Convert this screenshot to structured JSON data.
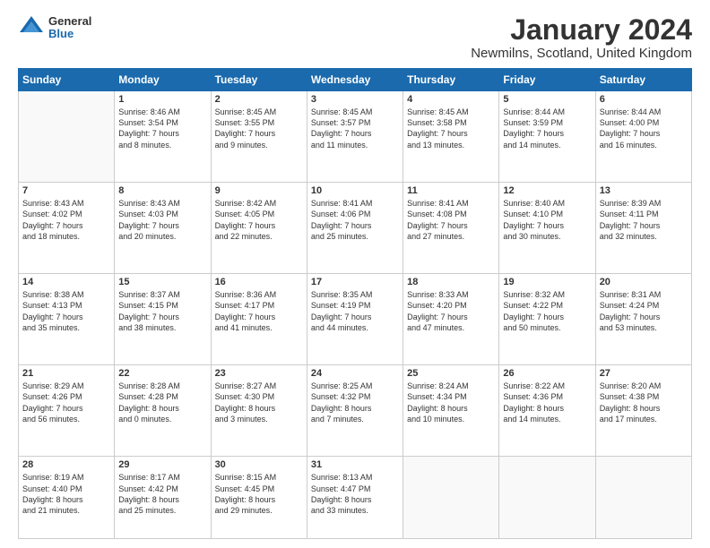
{
  "logo": {
    "general": "General",
    "blue": "Blue"
  },
  "title": "January 2024",
  "location": "Newmilns, Scotland, United Kingdom",
  "days_of_week": [
    "Sunday",
    "Monday",
    "Tuesday",
    "Wednesday",
    "Thursday",
    "Friday",
    "Saturday"
  ],
  "weeks": [
    [
      {
        "day": "",
        "info": ""
      },
      {
        "day": "1",
        "info": "Sunrise: 8:46 AM\nSunset: 3:54 PM\nDaylight: 7 hours\nand 8 minutes."
      },
      {
        "day": "2",
        "info": "Sunrise: 8:45 AM\nSunset: 3:55 PM\nDaylight: 7 hours\nand 9 minutes."
      },
      {
        "day": "3",
        "info": "Sunrise: 8:45 AM\nSunset: 3:57 PM\nDaylight: 7 hours\nand 11 minutes."
      },
      {
        "day": "4",
        "info": "Sunrise: 8:45 AM\nSunset: 3:58 PM\nDaylight: 7 hours\nand 13 minutes."
      },
      {
        "day": "5",
        "info": "Sunrise: 8:44 AM\nSunset: 3:59 PM\nDaylight: 7 hours\nand 14 minutes."
      },
      {
        "day": "6",
        "info": "Sunrise: 8:44 AM\nSunset: 4:00 PM\nDaylight: 7 hours\nand 16 minutes."
      }
    ],
    [
      {
        "day": "7",
        "info": "Sunrise: 8:43 AM\nSunset: 4:02 PM\nDaylight: 7 hours\nand 18 minutes."
      },
      {
        "day": "8",
        "info": "Sunrise: 8:43 AM\nSunset: 4:03 PM\nDaylight: 7 hours\nand 20 minutes."
      },
      {
        "day": "9",
        "info": "Sunrise: 8:42 AM\nSunset: 4:05 PM\nDaylight: 7 hours\nand 22 minutes."
      },
      {
        "day": "10",
        "info": "Sunrise: 8:41 AM\nSunset: 4:06 PM\nDaylight: 7 hours\nand 25 minutes."
      },
      {
        "day": "11",
        "info": "Sunrise: 8:41 AM\nSunset: 4:08 PM\nDaylight: 7 hours\nand 27 minutes."
      },
      {
        "day": "12",
        "info": "Sunrise: 8:40 AM\nSunset: 4:10 PM\nDaylight: 7 hours\nand 30 minutes."
      },
      {
        "day": "13",
        "info": "Sunrise: 8:39 AM\nSunset: 4:11 PM\nDaylight: 7 hours\nand 32 minutes."
      }
    ],
    [
      {
        "day": "14",
        "info": "Sunrise: 8:38 AM\nSunset: 4:13 PM\nDaylight: 7 hours\nand 35 minutes."
      },
      {
        "day": "15",
        "info": "Sunrise: 8:37 AM\nSunset: 4:15 PM\nDaylight: 7 hours\nand 38 minutes."
      },
      {
        "day": "16",
        "info": "Sunrise: 8:36 AM\nSunset: 4:17 PM\nDaylight: 7 hours\nand 41 minutes."
      },
      {
        "day": "17",
        "info": "Sunrise: 8:35 AM\nSunset: 4:19 PM\nDaylight: 7 hours\nand 44 minutes."
      },
      {
        "day": "18",
        "info": "Sunrise: 8:33 AM\nSunset: 4:20 PM\nDaylight: 7 hours\nand 47 minutes."
      },
      {
        "day": "19",
        "info": "Sunrise: 8:32 AM\nSunset: 4:22 PM\nDaylight: 7 hours\nand 50 minutes."
      },
      {
        "day": "20",
        "info": "Sunrise: 8:31 AM\nSunset: 4:24 PM\nDaylight: 7 hours\nand 53 minutes."
      }
    ],
    [
      {
        "day": "21",
        "info": "Sunrise: 8:29 AM\nSunset: 4:26 PM\nDaylight: 7 hours\nand 56 minutes."
      },
      {
        "day": "22",
        "info": "Sunrise: 8:28 AM\nSunset: 4:28 PM\nDaylight: 8 hours\nand 0 minutes."
      },
      {
        "day": "23",
        "info": "Sunrise: 8:27 AM\nSunset: 4:30 PM\nDaylight: 8 hours\nand 3 minutes."
      },
      {
        "day": "24",
        "info": "Sunrise: 8:25 AM\nSunset: 4:32 PM\nDaylight: 8 hours\nand 7 minutes."
      },
      {
        "day": "25",
        "info": "Sunrise: 8:24 AM\nSunset: 4:34 PM\nDaylight: 8 hours\nand 10 minutes."
      },
      {
        "day": "26",
        "info": "Sunrise: 8:22 AM\nSunset: 4:36 PM\nDaylight: 8 hours\nand 14 minutes."
      },
      {
        "day": "27",
        "info": "Sunrise: 8:20 AM\nSunset: 4:38 PM\nDaylight: 8 hours\nand 17 minutes."
      }
    ],
    [
      {
        "day": "28",
        "info": "Sunrise: 8:19 AM\nSunset: 4:40 PM\nDaylight: 8 hours\nand 21 minutes."
      },
      {
        "day": "29",
        "info": "Sunrise: 8:17 AM\nSunset: 4:42 PM\nDaylight: 8 hours\nand 25 minutes."
      },
      {
        "day": "30",
        "info": "Sunrise: 8:15 AM\nSunset: 4:45 PM\nDaylight: 8 hours\nand 29 minutes."
      },
      {
        "day": "31",
        "info": "Sunrise: 8:13 AM\nSunset: 4:47 PM\nDaylight: 8 hours\nand 33 minutes."
      },
      {
        "day": "",
        "info": ""
      },
      {
        "day": "",
        "info": ""
      },
      {
        "day": "",
        "info": ""
      }
    ]
  ]
}
